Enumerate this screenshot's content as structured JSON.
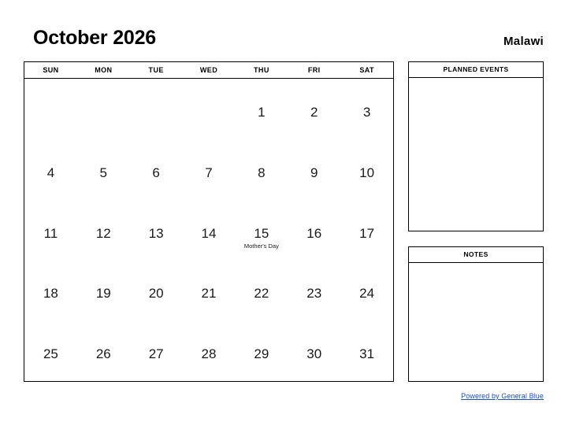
{
  "header": {
    "title": "October 2026",
    "region": "Malawi"
  },
  "calendar": {
    "weekdays": [
      "SUN",
      "MON",
      "TUE",
      "WED",
      "THU",
      "FRI",
      "SAT"
    ],
    "weeks": [
      [
        {
          "day": "",
          "event": ""
        },
        {
          "day": "",
          "event": ""
        },
        {
          "day": "",
          "event": ""
        },
        {
          "day": "",
          "event": ""
        },
        {
          "day": "1",
          "event": ""
        },
        {
          "day": "2",
          "event": ""
        },
        {
          "day": "3",
          "event": ""
        }
      ],
      [
        {
          "day": "4",
          "event": ""
        },
        {
          "day": "5",
          "event": ""
        },
        {
          "day": "6",
          "event": ""
        },
        {
          "day": "7",
          "event": ""
        },
        {
          "day": "8",
          "event": ""
        },
        {
          "day": "9",
          "event": ""
        },
        {
          "day": "10",
          "event": ""
        }
      ],
      [
        {
          "day": "11",
          "event": ""
        },
        {
          "day": "12",
          "event": ""
        },
        {
          "day": "13",
          "event": ""
        },
        {
          "day": "14",
          "event": ""
        },
        {
          "day": "15",
          "event": "Mother's Day"
        },
        {
          "day": "16",
          "event": ""
        },
        {
          "day": "17",
          "event": ""
        }
      ],
      [
        {
          "day": "18",
          "event": ""
        },
        {
          "day": "19",
          "event": ""
        },
        {
          "day": "20",
          "event": ""
        },
        {
          "day": "21",
          "event": ""
        },
        {
          "day": "22",
          "event": ""
        },
        {
          "day": "23",
          "event": ""
        },
        {
          "day": "24",
          "event": ""
        }
      ],
      [
        {
          "day": "25",
          "event": ""
        },
        {
          "day": "26",
          "event": ""
        },
        {
          "day": "27",
          "event": ""
        },
        {
          "day": "28",
          "event": ""
        },
        {
          "day": "29",
          "event": ""
        },
        {
          "day": "30",
          "event": ""
        },
        {
          "day": "31",
          "event": ""
        }
      ]
    ]
  },
  "panels": {
    "planned_events": {
      "title": "PLANNED EVENTS",
      "content": ""
    },
    "notes": {
      "title": "NOTES",
      "content": ""
    }
  },
  "footer": {
    "link_text": "Powered by General Blue",
    "link_color": "#1a4fcc"
  }
}
